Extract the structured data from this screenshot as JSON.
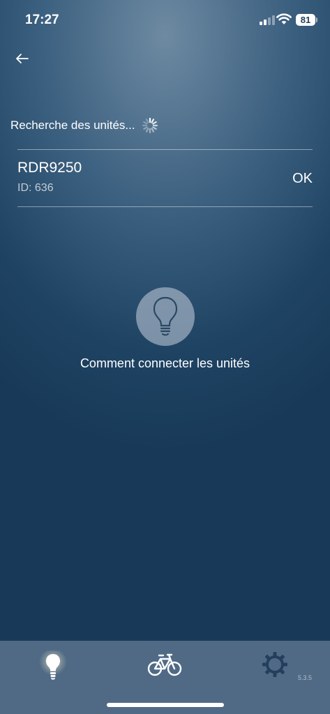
{
  "status_bar": {
    "time": "17:27",
    "battery": "81"
  },
  "header": {
    "back_icon": "arrow-left-icon"
  },
  "search": {
    "label": "Recherche des unités...",
    "spinner_icon": "loading-spinner-icon"
  },
  "devices": [
    {
      "name": "RDR9250",
      "id": "ID: 636",
      "status": "OK"
    }
  ],
  "help": {
    "icon": "lightbulb-icon",
    "label": "Comment connecter les unités"
  },
  "tab_bar": {
    "tabs": [
      {
        "icon": "lightbulb-icon",
        "active": true
      },
      {
        "icon": "bicycle-icon",
        "active": false
      },
      {
        "icon": "gear-icon",
        "active": false
      }
    ],
    "version": "5.3.5"
  },
  "colors": {
    "background_top": "#6e8aa2",
    "background_bottom": "#183a58",
    "tab_bar": "#506a86",
    "settings_icon": "#233f5c",
    "active_glow": "#fff6c8"
  }
}
